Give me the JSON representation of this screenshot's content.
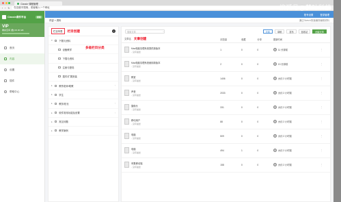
{
  "browser": {
    "tab_title": "Classin·课程管理",
    "url": "在百度中搜索，或者输入一个网址",
    "colors": {
      "close": "#ff5f57",
      "min": "#febc2e",
      "max": "#28c840"
    }
  },
  "watermark": "搜狐号@梦叶科技",
  "sidebar": {
    "brand": "Classin课件平台",
    "badge": "更新",
    "vip": "VIP",
    "user_line": "剩余空间 (数) 00.00 GB",
    "items": [
      {
        "label": "首页",
        "icon": "home-icon"
      },
      {
        "label": "内容",
        "icon": "folder-icon"
      },
      {
        "label": "设置",
        "icon": "gear-icon"
      },
      {
        "label": "插件",
        "icon": "plugin-icon"
      },
      {
        "label": "帮助中心",
        "icon": "help-icon"
      }
    ]
  },
  "topbar": {
    "links": [
      "账号设置",
      "登录管理"
    ]
  },
  "breadcrumb": {
    "path": "内容 > 资料",
    "notice": "通过Sketch快速编排编辑资料"
  },
  "categories": {
    "list_button": "栏目列表",
    "annotation_create": "栏目创建",
    "annotation_multi": "多级栏目分类",
    "items": [
      {
        "label": "下载与资料",
        "level": 0
      },
      {
        "label": "设备教学",
        "level": 1
      },
      {
        "label": "下载与资料",
        "level": 1
      },
      {
        "label": "注册与登陆",
        "level": 1
      },
      {
        "label": "插件/扩展安装",
        "level": 1
      },
      {
        "label": "教育老师/助教",
        "level": 0
      },
      {
        "label": "学生",
        "level": 0
      },
      {
        "label": "教务/校长",
        "level": 0
      },
      {
        "label": "软件常用功能及设置",
        "level": 0
      },
      {
        "label": "常见问题",
        "level": 0
      },
      {
        "label": "教学案例",
        "level": 0
      }
    ]
  },
  "list": {
    "search_placeholder": "搜索文章",
    "filters": [
      "全部",
      "草稿",
      "发布",
      "回收站"
    ],
    "active_filter": "全部",
    "create_button": "创建文章",
    "annotation": "文章创建",
    "columns": [
      "文章名",
      "浏览量",
      "收藏",
      "分享",
      "更新时间"
    ],
    "rows": [
      {
        "title": "Mac电脑清理系统提供新版本",
        "desc": "- 没有描述",
        "views": "1",
        "fav": "0",
        "share": "0",
        "author": "",
        "time": "11 分钟前"
      },
      {
        "title": "Mac电脑清理系统使用新版本",
        "desc": "- 没有描述",
        "views": "2",
        "fav": "0",
        "share": "0",
        "author": "",
        "time": "13 分钟前"
      },
      {
        "title": "教室",
        "desc": "- 没有描述",
        "views": "1406",
        "fav": "0",
        "share": "0",
        "author": "",
        "time": "大约 2 小时前"
      },
      {
        "title": "声音",
        "desc": "- 没有描述",
        "views": "2033",
        "fav": "0",
        "share": "0",
        "author": "",
        "time": "大约 2 小时前"
      },
      {
        "title": "摄像头",
        "desc": "- 没有描述",
        "views": "331",
        "fav": "0",
        "share": "0",
        "author": "",
        "time": "大约 2 小时前"
      },
      {
        "title": "移动用户",
        "desc": "- 没有描述",
        "views": "88",
        "fav": "0",
        "share": "0",
        "author": "",
        "time": "大约 2 小时前"
      },
      {
        "title": "电脑",
        "desc": "- 没有描述",
        "views": "509",
        "fav": "0",
        "share": "0",
        "author": "",
        "time": "大约 2 小时前"
      },
      {
        "title": "电脑",
        "desc": "- 没有描述",
        "views": "494",
        "fav": "1",
        "share": "0",
        "author": "",
        "time": "大约 2 小时前"
      },
      {
        "title": "苹果移动端",
        "desc": "- 没有描述",
        "views": "158",
        "fav": "0",
        "share": "0",
        "author": "",
        "time": "大约 2 小时前"
      }
    ]
  }
}
